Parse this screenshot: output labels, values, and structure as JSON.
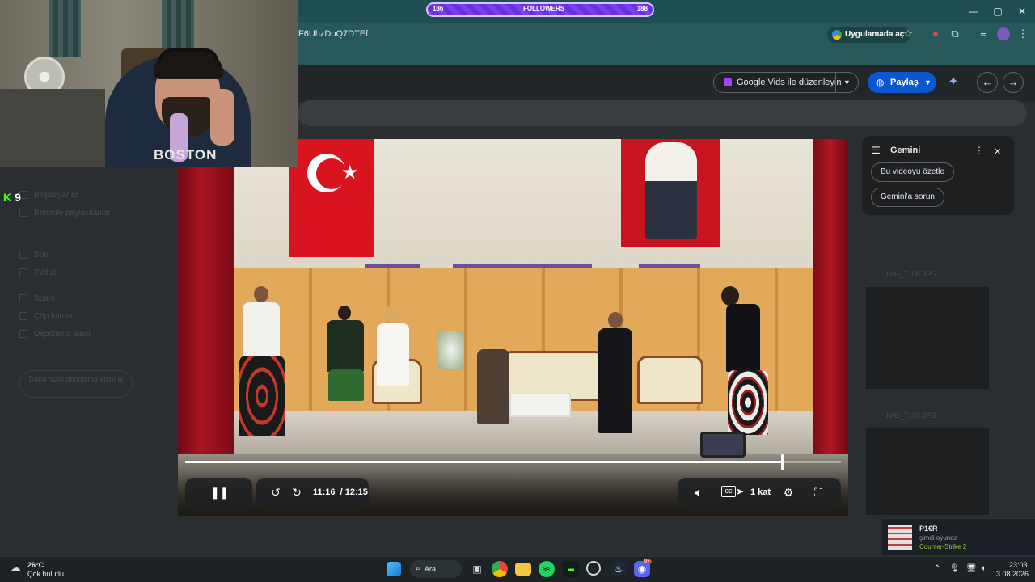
{
  "browser": {
    "url_fragment": "F6UhzDoQ7DTEf",
    "open_in_app": "Uygulamada aç",
    "window_controls": {
      "minimize": "—",
      "maximize": "▢",
      "close": "✕"
    }
  },
  "followers_widget": {
    "left_count": "186",
    "label": "FOLLOWERS",
    "right_count": "188",
    "progress": 0.99
  },
  "drive": {
    "edit_with_vids": "Google Vids ile düzenleyin",
    "share": "Paylaş",
    "sidebar_faded": [
      "Bilgisayarlar",
      "Benimle paylaşılanlar",
      "Son",
      "Yıldızlı",
      "Spam",
      "Çöp kutusu",
      "Depolama alanı"
    ],
    "storage_text": "Daha fazla depolama alanı al",
    "right_items": [
      "IMG_7105.JPG",
      "IMG_7103.JPG"
    ]
  },
  "player": {
    "current_time": "11:16",
    "duration": "/ 12:15",
    "progress": 0.91,
    "speed": "1 kat",
    "icons": {
      "play_pause": "pause-icon",
      "rewind": "rewind-10-icon",
      "forward": "forward-10-icon",
      "volume": "volume-icon",
      "captions": "captions-icon",
      "settings": "settings-icon",
      "fullscreen": "fullscreen-icon"
    }
  },
  "gemini": {
    "title": "Gemini",
    "chips": [
      "Bu videoyu özetle",
      "Gemini'a sorun"
    ]
  },
  "webcam": {
    "shirt_text": "BOSTON"
  },
  "kick": {
    "logo": "K",
    "viewers": "9"
  },
  "steam_toast": {
    "user": "P1€R",
    "status": "şimdi oyunda",
    "game": "Counter-Strike 2"
  },
  "taskbar": {
    "weather_temp": "26°C",
    "weather_desc": "Çok bulutlu",
    "search": "Ara",
    "discord_badge": "9+",
    "time": "23:03",
    "date": "3.08.2026"
  },
  "colors": {
    "chrome_title": "#1f4f52",
    "drive_bg": "#2b2e31",
    "share_blue": "#0b57d0",
    "followers_purple": "#6a2fe0",
    "kick_green": "#53fc18"
  }
}
